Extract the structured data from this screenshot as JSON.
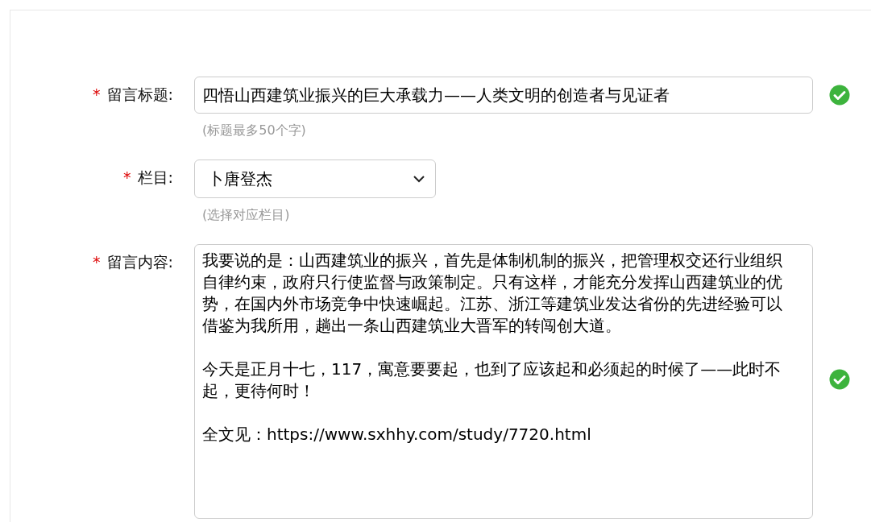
{
  "form": {
    "fields": [
      {
        "kind": "text",
        "marker": "*",
        "label": "留言标题:",
        "value": "四悟山西建筑业振兴的巨大承载力——人类文明的创造者与见证者",
        "hint": "(标题最多50个字)",
        "valid": true
      },
      {
        "kind": "select",
        "marker": "*",
        "label": "栏目:",
        "value": "卜唐登杰",
        "hint": "(选择对应栏目)",
        "valid": false
      },
      {
        "kind": "textarea",
        "marker": "*",
        "label": "留言内容:",
        "paragraphs": [
          "我要说的是：山西建筑业的振兴，首先是体制机制的振兴，把管理权交还行业组织自律约束，政府只行使监督与政策制定。只有这样，才能充分发挥山西建筑业的优势，在国内外市场竞争中快速崛起。江苏、浙江等建筑业发达省份的先进经验可以借鉴为我所用，趟出一条山西建筑业大晋军的转闯创大道。",
          "今天是正月十七，117，寓意要要起，也到了应该起和必须起的时候了——此时不起，更待何时！",
          "全文见：https://www.sxhhy.com/study/7720.html"
        ],
        "valid": true
      }
    ]
  }
}
